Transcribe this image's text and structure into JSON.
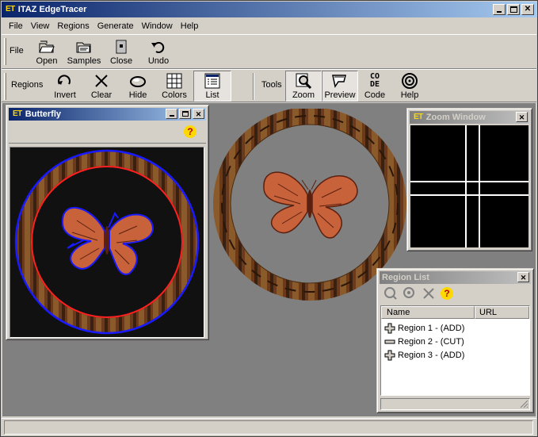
{
  "app": {
    "title": "ITAZ EdgeTracer",
    "logo": "ET"
  },
  "menu": [
    "File",
    "View",
    "Regions",
    "Generate",
    "Window",
    "Help"
  ],
  "file_toolbar": {
    "group_label": "File",
    "buttons": [
      {
        "label": "Open",
        "icon": "open-folder-icon"
      },
      {
        "label": "Samples",
        "icon": "samples-icon"
      },
      {
        "label": "Close",
        "icon": "close-file-icon"
      },
      {
        "label": "Undo",
        "icon": "undo-icon"
      }
    ]
  },
  "regions_toolbar": {
    "group_label": "Regions",
    "buttons": [
      {
        "label": "Invert",
        "icon": "invert-icon"
      },
      {
        "label": "Clear",
        "icon": "clear-x-icon"
      },
      {
        "label": "Hide",
        "icon": "hide-icon"
      },
      {
        "label": "Colors",
        "icon": "colors-grid-icon"
      },
      {
        "label": "List",
        "icon": "list-icon",
        "pressed": true
      }
    ]
  },
  "tools_toolbar": {
    "group_label": "Tools",
    "buttons": [
      {
        "label": "Zoom",
        "icon": "zoom-icon",
        "pressed": true
      },
      {
        "label": "Preview",
        "icon": "preview-icon",
        "pressed": true
      },
      {
        "label": "Code",
        "icon": "code-icon"
      },
      {
        "label": "Help",
        "icon": "help-icon"
      }
    ]
  },
  "code_icon_text": [
    "CO",
    "DE"
  ],
  "butterfly_window": {
    "title": "Butterfly",
    "logo": "ET",
    "help_glyph": "?"
  },
  "zoom_window": {
    "title": "Zoom Window",
    "logo": "ET"
  },
  "region_list": {
    "title": "Region List",
    "columns": [
      "Name",
      "URL"
    ],
    "rows": [
      {
        "name": "Region 1 - (ADD)",
        "url": "",
        "icon": "add-region-icon"
      },
      {
        "name": "Region 2 - (CUT)",
        "url": "",
        "icon": "cut-region-icon"
      },
      {
        "name": "Region 3 - (ADD)",
        "url": "",
        "icon": "add-region-icon"
      }
    ],
    "help_glyph": "?"
  },
  "colors": {
    "titlebar": "#0a246a",
    "outline_blue": "#1a1aff",
    "outline_red": "#ff2020",
    "frame_brown": "#6b3a1a",
    "butterfly": "#c8623a"
  }
}
